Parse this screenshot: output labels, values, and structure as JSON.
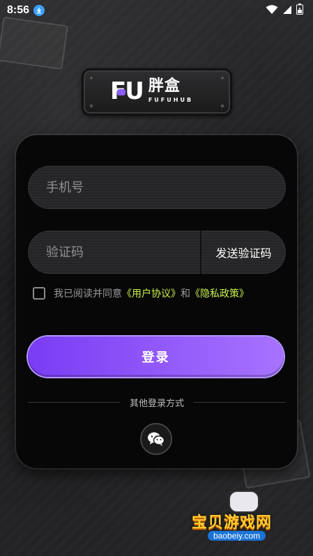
{
  "status_bar": {
    "time": "8:56",
    "icons": [
      "download-icon",
      "wifi-icon",
      "signal-icon",
      "battery-icon"
    ]
  },
  "logo": {
    "brand": "FU",
    "chinese": "胖盒",
    "english": "FUFUHUB"
  },
  "form": {
    "phone_placeholder": "手机号",
    "code_placeholder": "验证码",
    "send_code_label": "发送验证码",
    "agreement": {
      "prefix": "我已阅读并同意",
      "user_agreement": "《用户协议》",
      "and": "和",
      "privacy_policy": "《隐私政策》",
      "checked": false
    },
    "login_label": "登录"
  },
  "other_login": {
    "label": "其他登录方式",
    "options": [
      "wechat-icon"
    ]
  },
  "watermark": {
    "title": "宝贝游戏网",
    "url": "baobeiy.com"
  },
  "colors": {
    "accent_purple": "#8a4cff",
    "link_green": "#c9f24a",
    "panel": "#070707"
  }
}
